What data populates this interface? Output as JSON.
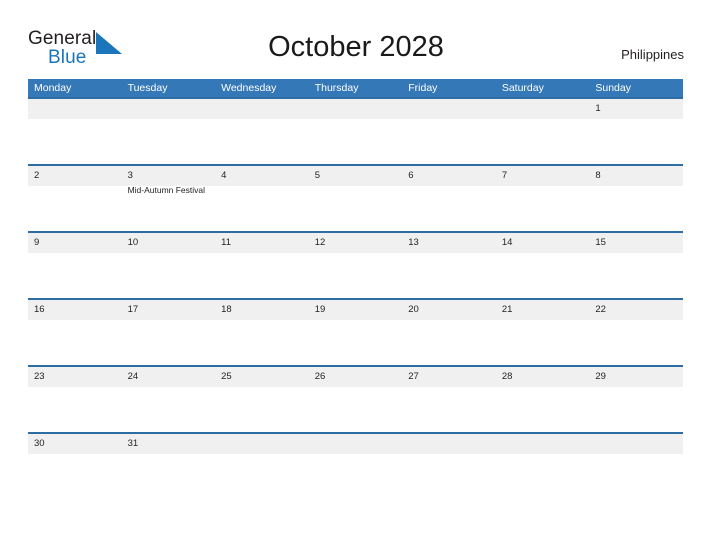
{
  "brand": {
    "name_part1": "General",
    "name_part2": "Blue",
    "sail_icon": "sail-triangle-icon",
    "color_dark": "#231f20",
    "color_blue": "#1b75bb"
  },
  "header": {
    "title": "October 2028",
    "country": "Philippines"
  },
  "theme": {
    "header_blue": "#3478b8",
    "row_border_blue": "#2e6da4",
    "band_gray": "#f0f0f0",
    "text_dark": "#231f20"
  },
  "calendar": {
    "month": "October",
    "year": "2028",
    "weekday_headers": [
      "Monday",
      "Tuesday",
      "Wednesday",
      "Thursday",
      "Friday",
      "Saturday",
      "Sunday"
    ],
    "weeks": [
      [
        {
          "day": "",
          "event": ""
        },
        {
          "day": "",
          "event": ""
        },
        {
          "day": "",
          "event": ""
        },
        {
          "day": "",
          "event": ""
        },
        {
          "day": "",
          "event": ""
        },
        {
          "day": "",
          "event": ""
        },
        {
          "day": "1",
          "event": ""
        }
      ],
      [
        {
          "day": "2",
          "event": ""
        },
        {
          "day": "3",
          "event": "Mid-Autumn Festival"
        },
        {
          "day": "4",
          "event": ""
        },
        {
          "day": "5",
          "event": ""
        },
        {
          "day": "6",
          "event": ""
        },
        {
          "day": "7",
          "event": ""
        },
        {
          "day": "8",
          "event": ""
        }
      ],
      [
        {
          "day": "9",
          "event": ""
        },
        {
          "day": "10",
          "event": ""
        },
        {
          "day": "11",
          "event": ""
        },
        {
          "day": "12",
          "event": ""
        },
        {
          "day": "13",
          "event": ""
        },
        {
          "day": "14",
          "event": ""
        },
        {
          "day": "15",
          "event": ""
        }
      ],
      [
        {
          "day": "16",
          "event": ""
        },
        {
          "day": "17",
          "event": ""
        },
        {
          "day": "18",
          "event": ""
        },
        {
          "day": "19",
          "event": ""
        },
        {
          "day": "20",
          "event": ""
        },
        {
          "day": "21",
          "event": ""
        },
        {
          "day": "22",
          "event": ""
        }
      ],
      [
        {
          "day": "23",
          "event": ""
        },
        {
          "day": "24",
          "event": ""
        },
        {
          "day": "25",
          "event": ""
        },
        {
          "day": "26",
          "event": ""
        },
        {
          "day": "27",
          "event": ""
        },
        {
          "day": "28",
          "event": ""
        },
        {
          "day": "29",
          "event": ""
        }
      ],
      [
        {
          "day": "30",
          "event": ""
        },
        {
          "day": "31",
          "event": ""
        },
        {
          "day": "",
          "event": ""
        },
        {
          "day": "",
          "event": ""
        },
        {
          "day": "",
          "event": ""
        },
        {
          "day": "",
          "event": ""
        },
        {
          "day": "",
          "event": ""
        }
      ]
    ]
  }
}
